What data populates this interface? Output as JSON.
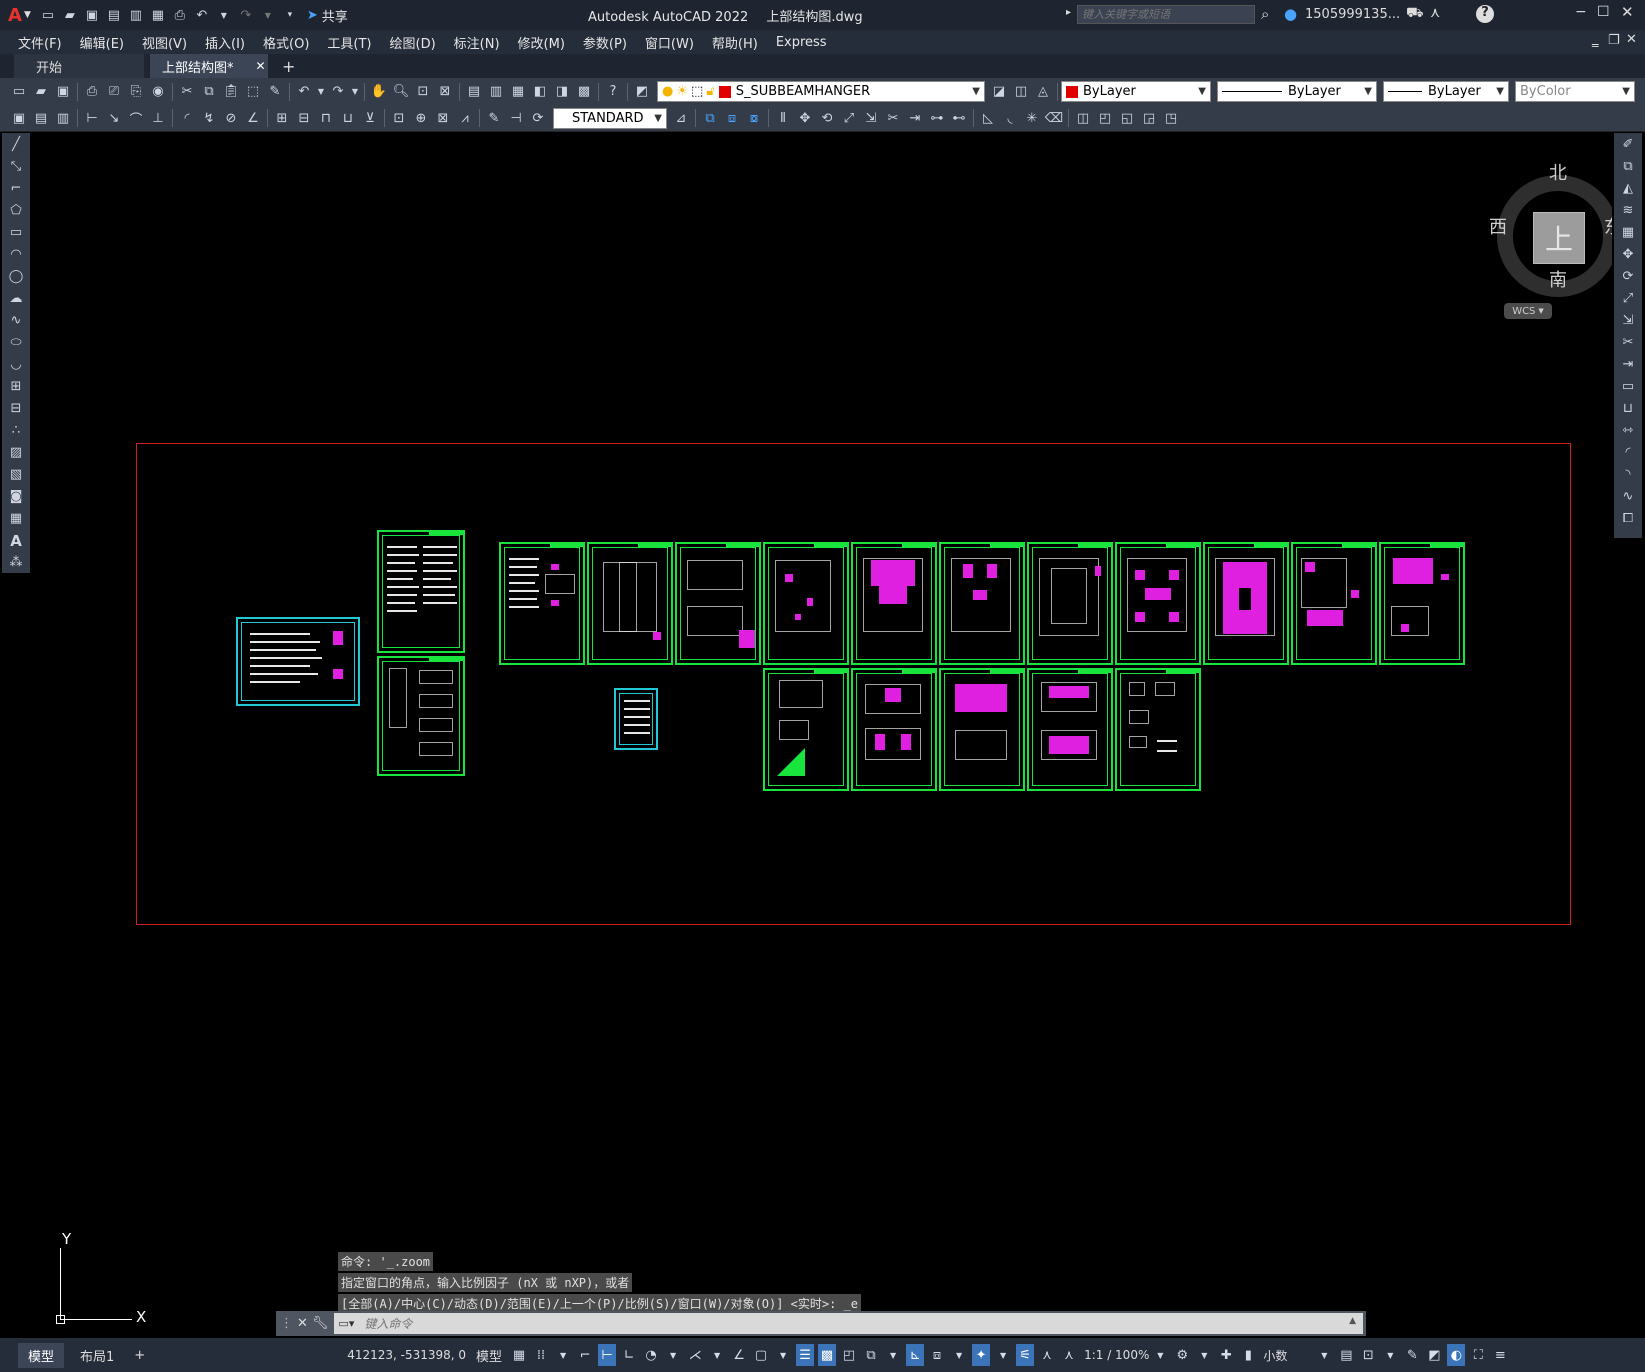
{
  "title": {
    "logo": "A",
    "app": "Autodesk AutoCAD 2022",
    "file": "上部结构图.dwg",
    "share": "共享",
    "search_placeholder": "键入关键字或短语",
    "user": "1505999135...",
    "help": "?"
  },
  "menu": [
    "文件(F)",
    "编辑(E)",
    "视图(V)",
    "插入(I)",
    "格式(O)",
    "工具(T)",
    "绘图(D)",
    "标注(N)",
    "修改(M)",
    "参数(P)",
    "窗口(W)",
    "帮助(H)",
    "Express"
  ],
  "tabs": {
    "start": "开始",
    "doc": "上部结构图*",
    "add": "+"
  },
  "toolbar": {
    "layer": "S_SUBBEAMHANGER",
    "color": "ByLayer",
    "linetype": "ByLayer",
    "lineweight": "ByLayer",
    "plotstyle": "ByColor",
    "textstyle": "STANDARD"
  },
  "viewcube": {
    "north": "北",
    "south": "南",
    "east": "东",
    "west": "西",
    "face": "上",
    "wcs": "WCS"
  },
  "ucs": {
    "x": "X",
    "y": "Y"
  },
  "command": {
    "history": [
      "命令: '_.zoom",
      "指定窗口的角点，输入比例因子 (nX 或 nXP)，或者",
      "[全部(A)/中心(C)/动态(D)/范围(E)/上一个(P)/比例(S)/窗口(W)/对象(O)] <实时>: _e"
    ],
    "placeholder": "键入命令"
  },
  "status": {
    "model_tab": "模型",
    "layout_tab": "布局1",
    "add": "+",
    "coords": "412123, -531398, 0",
    "model": "模型",
    "scale": "1:1 / 100%",
    "units": "小数"
  }
}
